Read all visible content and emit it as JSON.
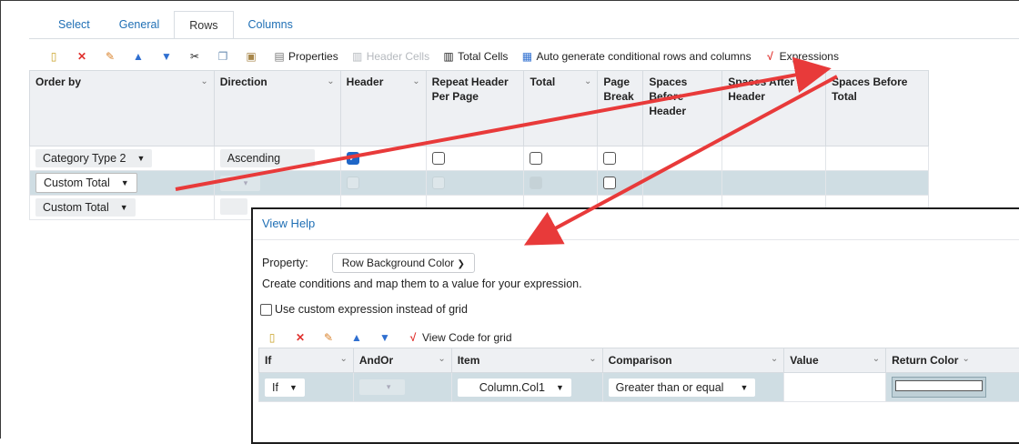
{
  "tabs": [
    "Select",
    "General",
    "Rows",
    "Columns"
  ],
  "toolbar": {
    "properties": "Properties",
    "header_cells": "Header Cells",
    "total_cells": "Total Cells",
    "auto_generate": "Auto generate conditional rows and columns",
    "expressions": "Expressions"
  },
  "grid": {
    "headers": {
      "order_by": "Order by",
      "direction": "Direction",
      "header": "Header",
      "repeat": "Repeat Header Per Page",
      "total": "Total",
      "page_break": "Page Break",
      "sp_before_header": "Spaces Before Header",
      "sp_after_header": "Spaces After Header",
      "sp_before_total": "Spaces Before Total"
    },
    "rows": [
      {
        "order_by": "Category Type 2",
        "direction": "Ascending"
      },
      {
        "order_by": "Custom Total",
        "direction": ""
      },
      {
        "order_by": "Custom Total",
        "direction": ""
      }
    ]
  },
  "dialog": {
    "help": "View Help",
    "property_label": "Property:",
    "property_value": "Row Background Color",
    "description": "Create conditions and map them to a value for your expression.",
    "custom_expr": "Use custom expression instead of grid",
    "view_code": "View Code for grid",
    "headers": {
      "if": "If",
      "andor": "AndOr",
      "item": "Item",
      "comparison": "Comparison",
      "value": "Value",
      "return_color": "Return Color"
    },
    "row": {
      "if": "If",
      "item": "Column.Col1",
      "comparison": "Greater than or equal"
    }
  },
  "colors": {
    "accent": "#1f6fb5",
    "selected_row": "#cfdde3",
    "arrow": "#e83a3a"
  }
}
